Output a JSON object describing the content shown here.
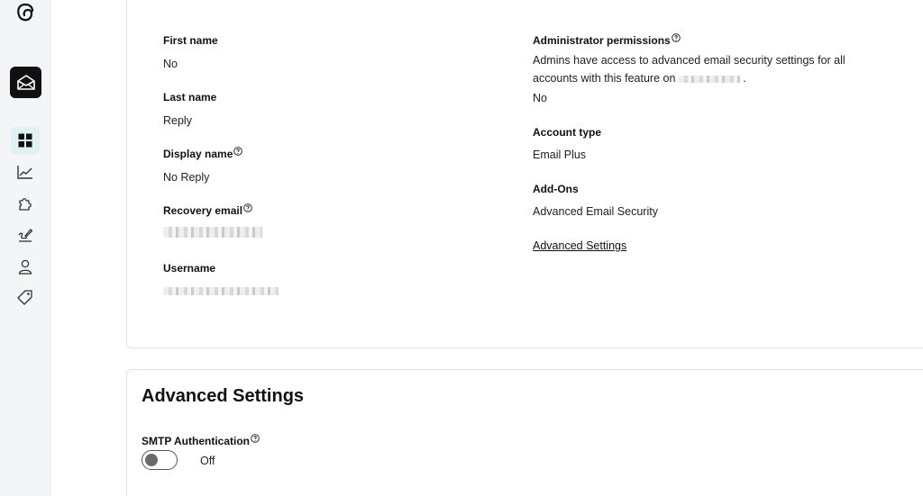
{
  "sidebar": {
    "items": [
      {
        "name": "dashboard",
        "active": true
      },
      {
        "name": "analytics",
        "active": false
      },
      {
        "name": "add-ons",
        "active": false
      },
      {
        "name": "signature",
        "active": false
      },
      {
        "name": "account",
        "active": false
      },
      {
        "name": "tags",
        "active": false
      }
    ]
  },
  "account": {
    "first_name_label": "First name",
    "first_name_value": "No",
    "last_name_label": "Last name",
    "last_name_value": "Reply",
    "display_name_label": "Display name",
    "display_name_value": "No Reply",
    "recovery_email_label": "Recovery email",
    "username_label": "Username",
    "admin_permissions_label": "Administrator permissions",
    "admin_permissions_desc_1": "Admins have access to advanced email security settings for all",
    "admin_permissions_desc_2": "accounts with this feature on",
    "admin_permissions_desc_end": ".",
    "admin_permissions_value": "No",
    "account_type_label": "Account type",
    "account_type_value": "Email Plus",
    "addons_label": "Add-Ons",
    "addons_value": "Advanced Email Security",
    "advanced_settings_link": "Advanced Settings"
  },
  "advanced": {
    "title": "Advanced Settings",
    "smtp_label": "SMTP Authentication",
    "smtp_state": "Off"
  },
  "colors": {
    "active_nav_bg": "#dff1f1",
    "app_tile_bg": "#111111",
    "sidebar_bg": "#f4f5f6"
  }
}
